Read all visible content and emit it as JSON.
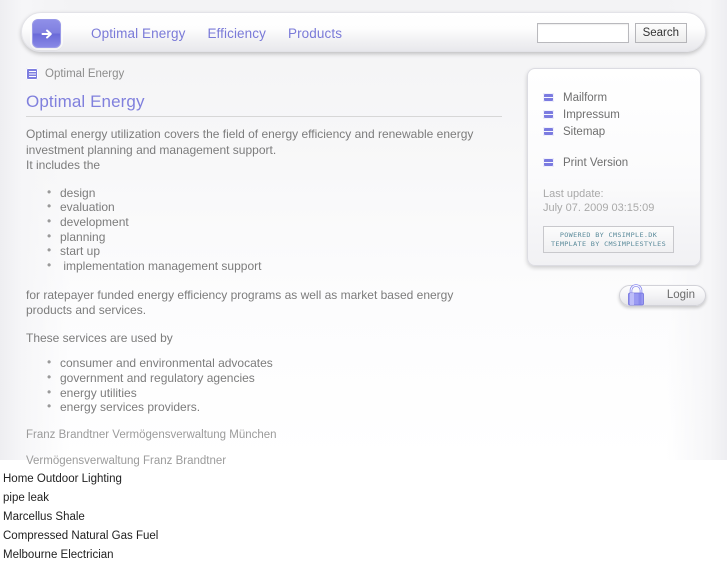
{
  "header": {
    "logo_icon": "arrow-right-icon",
    "nav": [
      {
        "label": "Optimal Energy"
      },
      {
        "label": "Efficiency"
      },
      {
        "label": "Products"
      }
    ],
    "search": {
      "value": "",
      "placeholder": "",
      "button_label": "Search"
    }
  },
  "breadcrumb": {
    "icon": "document-icon",
    "label": "Optimal Energy"
  },
  "main": {
    "title": "Optimal Energy",
    "intro": "Optimal energy utilization covers the field of energy efficiency and renewable energy investment planning and management support.\nIt includes the",
    "list_one": [
      "design",
      "evaluation",
      "development",
      "planning",
      "start up",
      " implementation management support"
    ],
    "para_two": "for ratepayer funded energy efficiency programs as well as market based energy products and services.",
    "para_three": "These services are used by",
    "list_two": [
      "consumer and environmental advocates",
      "government and regulatory agencies",
      "energy utilities",
      "energy services providers."
    ],
    "footnote_one": "Franz Brandtner Vermögensverwaltung München",
    "footnote_two": "Vermögensverwaltung Franz Brandtner"
  },
  "sidebar": {
    "links": [
      {
        "label": "Mailform",
        "icon": "page-icon"
      },
      {
        "label": "Impressum",
        "icon": "page-icon"
      },
      {
        "label": "Sitemap",
        "icon": "page-icon"
      }
    ],
    "print": {
      "label": "Print Version",
      "icon": "page-icon"
    },
    "last_update_label": "Last update:",
    "last_update_value": "July 07. 2009 03:15:09",
    "badge_line_one": "POWERED BY CMSIMPLE.DK",
    "badge_line_two": "TEMPLATE BY CMSIMPLESTYLES"
  },
  "login": {
    "label": "Login",
    "icon": "padlock-icon"
  },
  "bottom_links": [
    "Home Outdoor Lighting",
    "pipe leak",
    "Marcellus Shale",
    "Compressed Natural Gas Fuel",
    "Melbourne Electrician"
  ],
  "colors": {
    "accent": "#7f7fe0",
    "title": "#8080dd",
    "body_text": "#7c7c7c",
    "muted": "#a9a9a9",
    "badge_text": "#5a8a9a"
  }
}
